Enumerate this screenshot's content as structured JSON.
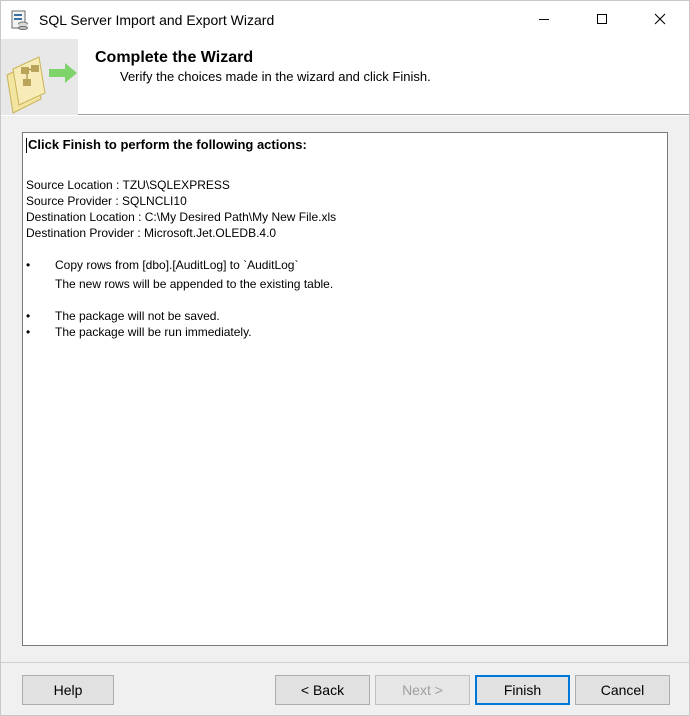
{
  "window": {
    "title": "SQL Server Import and Export Wizard"
  },
  "header": {
    "title": "Complete the Wizard",
    "subtitle": "Verify the choices made in the wizard and click Finish."
  },
  "summary": {
    "heading": "Click Finish to perform the following actions:",
    "details": [
      "Source Location : TZU\\SQLEXPRESS",
      "Source Provider : SQLNCLI10",
      "Destination Location : C:\\My Desired Path\\My New File.xls",
      "Destination Provider : Microsoft.Jet.OLEDB.4.0"
    ],
    "bullet": "•",
    "action_copy": "Copy rows from [dbo].[AuditLog] to `AuditLog`",
    "action_copy_note": "The new rows will be appended to the existing table.",
    "action_save": "The package will not be saved.",
    "action_run": "The package will be run immediately."
  },
  "buttons": {
    "help": "Help",
    "back": "< Back",
    "next": "Next >",
    "finish": "Finish",
    "cancel": "Cancel"
  },
  "icons": {
    "app": "wizard-app-icon",
    "header": "wizard-graphic",
    "minimize": "minimize-icon",
    "maximize": "maximize-icon",
    "close": "close-icon"
  },
  "colors": {
    "accent": "#0078d7",
    "panel": "#f0f0f0",
    "disabled_text": "#a0a0a0"
  }
}
